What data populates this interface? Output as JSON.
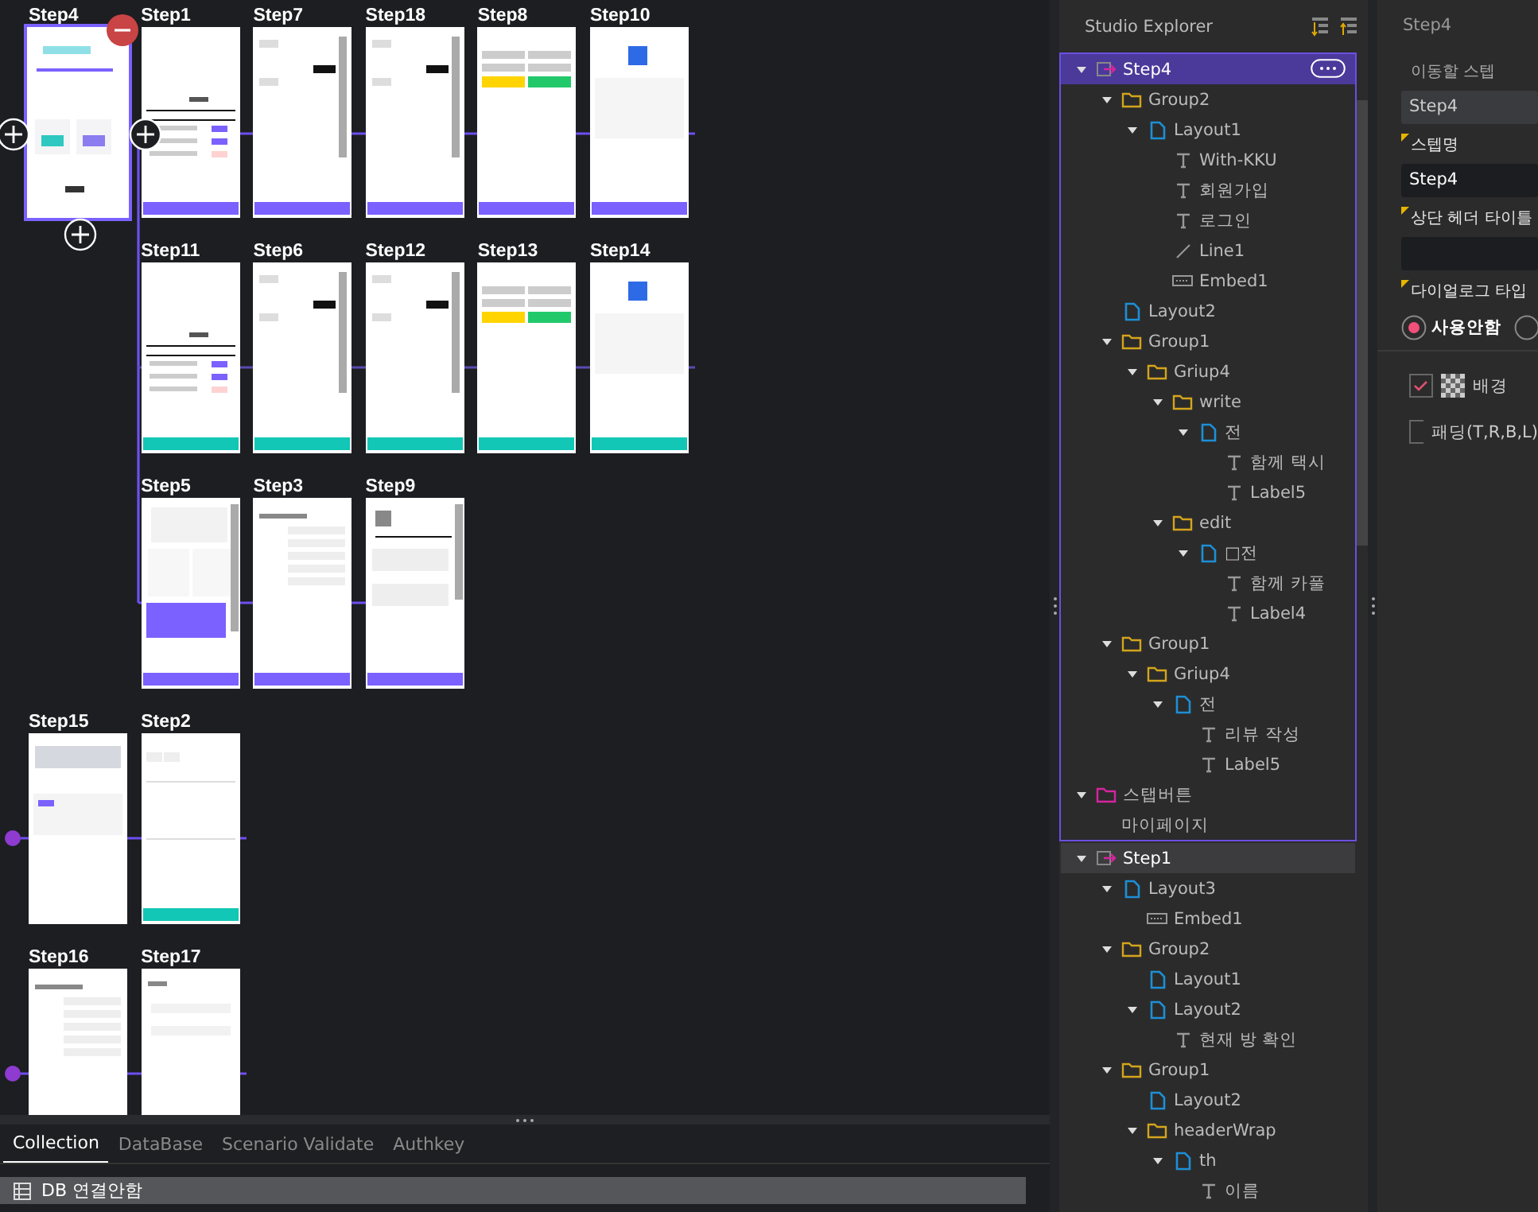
{
  "canvas": {
    "rows": [
      {
        "indented": false,
        "steps": [
          {
            "label": "Step4",
            "selected": true,
            "kind": "login"
          },
          {
            "label": "Step1",
            "selected": false,
            "kind": "table",
            "color": "#7b61ff"
          },
          {
            "label": "Step7",
            "selected": false,
            "kind": "chat",
            "color": "#7b61ff"
          },
          {
            "label": "Step18",
            "selected": false,
            "kind": "chat",
            "color": "#7b61ff"
          },
          {
            "label": "Step8",
            "selected": false,
            "kind": "options",
            "color": "#7b61ff"
          },
          {
            "label": "Step10",
            "selected": false,
            "kind": "done",
            "color": "#7b61ff"
          }
        ]
      },
      {
        "indented": true,
        "steps": [
          {
            "label": "Step11",
            "selected": false,
            "kind": "table",
            "color": "#12c7b5"
          },
          {
            "label": "Step6",
            "selected": false,
            "kind": "chat",
            "color": "#12c7b5"
          },
          {
            "label": "Step12",
            "selected": false,
            "kind": "chat",
            "color": "#12c7b5"
          },
          {
            "label": "Step13",
            "selected": false,
            "kind": "options",
            "color": "#12c7b5"
          },
          {
            "label": "Step14",
            "selected": false,
            "kind": "done",
            "color": "#12c7b5"
          }
        ]
      },
      {
        "indented": true,
        "steps": [
          {
            "label": "Step5",
            "selected": false,
            "kind": "mypage",
            "color": "#7b61ff"
          },
          {
            "label": "Step3",
            "selected": false,
            "kind": "form",
            "color": "#7b61ff"
          },
          {
            "label": "Step9",
            "selected": false,
            "kind": "review",
            "color": "#7b61ff"
          }
        ]
      },
      {
        "indented": false,
        "steps": [
          {
            "label": "Step15",
            "selected": false,
            "kind": "list"
          },
          {
            "label": "Step2",
            "selected": false,
            "kind": "write",
            "color": "#12c7b5"
          }
        ]
      },
      {
        "indented": false,
        "steps": [
          {
            "label": "Step16",
            "selected": false,
            "kind": "form"
          },
          {
            "label": "Step17",
            "selected": false,
            "kind": "simpleform"
          }
        ]
      }
    ]
  },
  "bottom_panel": {
    "tabs": [
      {
        "label": "Collection",
        "selected": true
      },
      {
        "label": "DataBase",
        "selected": false
      },
      {
        "label": "Scenario Validate",
        "selected": false
      },
      {
        "label": "Authkey",
        "selected": false
      }
    ],
    "status": "DB 연결안함"
  },
  "explorer": {
    "title": "Studio Explorer",
    "tree": [
      {
        "label": "Step4",
        "kind": "step",
        "selected": true,
        "expanded": true,
        "children": [
          {
            "label": "Group2",
            "kind": "folder",
            "expanded": true,
            "children": [
              {
                "label": "Layout1",
                "kind": "layout",
                "expanded": true,
                "children": [
                  {
                    "label": "With-KKU",
                    "kind": "text"
                  },
                  {
                    "label": "회원가입",
                    "kind": "text"
                  },
                  {
                    "label": "로그인",
                    "kind": "text"
                  },
                  {
                    "label": "Line1",
                    "kind": "line"
                  },
                  {
                    "label": "Embed1",
                    "kind": "embed"
                  }
                ]
              }
            ]
          },
          {
            "label": "Layout2",
            "kind": "layout"
          },
          {
            "label": "Group1",
            "kind": "folder",
            "expanded": true,
            "children": [
              {
                "label": "Griup4",
                "kind": "folder",
                "expanded": true,
                "children": [
                  {
                    "label": "write",
                    "kind": "folder",
                    "expanded": true,
                    "children": [
                      {
                        "label": "전",
                        "kind": "layout",
                        "expanded": true,
                        "children": [
                          {
                            "label": "함께 택시",
                            "kind": "text"
                          },
                          {
                            "label": "Label5",
                            "kind": "text"
                          }
                        ]
                      }
                    ]
                  },
                  {
                    "label": "edit",
                    "kind": "folder",
                    "expanded": true,
                    "children": [
                      {
                        "label": "□전",
                        "kind": "layout",
                        "expanded": true,
                        "children": [
                          {
                            "label": "함께 카풀",
                            "kind": "text"
                          },
                          {
                            "label": "Label4",
                            "kind": "text"
                          }
                        ]
                      }
                    ]
                  }
                ]
              }
            ]
          },
          {
            "label": "Group1",
            "kind": "folder",
            "expanded": true,
            "children": [
              {
                "label": "Griup4",
                "kind": "folder",
                "expanded": true,
                "children": [
                  {
                    "label": "전",
                    "kind": "layout",
                    "expanded": true,
                    "children": [
                      {
                        "label": "리뷰 작성",
                        "kind": "text"
                      },
                      {
                        "label": "Label5",
                        "kind": "text"
                      }
                    ]
                  }
                ]
              }
            ]
          },
          {
            "label": "스탭버튼",
            "kind": "stepbutton",
            "expanded": true,
            "children": [
              {
                "label": "마이페이지",
                "kind": "plain"
              }
            ]
          }
        ]
      },
      {
        "label": "Step1",
        "kind": "step",
        "selected": false,
        "expanded": true,
        "children": [
          {
            "label": "Layout3",
            "kind": "layout",
            "expanded": true,
            "children": [
              {
                "label": "Embed1",
                "kind": "embed"
              }
            ]
          },
          {
            "label": "Group2",
            "kind": "folder",
            "expanded": true,
            "children": [
              {
                "label": "Layout1",
                "kind": "layout"
              },
              {
                "label": "Layout2",
                "kind": "layout",
                "expanded": true,
                "children": [
                  {
                    "label": "현재 방 확인",
                    "kind": "text"
                  }
                ]
              }
            ]
          },
          {
            "label": "Group1",
            "kind": "folder",
            "expanded": true,
            "children": [
              {
                "label": "Layout2",
                "kind": "layout"
              },
              {
                "label": "headerWrap",
                "kind": "folder",
                "expanded": true,
                "children": [
                  {
                    "label": "th",
                    "kind": "layout",
                    "expanded": true,
                    "children": [
                      {
                        "label": "이름",
                        "kind": "text"
                      }
                    ]
                  }
                ]
              }
            ]
          }
        ]
      }
    ]
  },
  "properties": {
    "title": "Step4",
    "fields": [
      {
        "label": "이동할 스텝",
        "kind": "readonly",
        "required": false,
        "value": "Step4"
      },
      {
        "label": "스텝명",
        "kind": "input",
        "required": true,
        "value": "Step4"
      },
      {
        "label": "상단 헤더 타이틀",
        "kind": "input",
        "required": true
      }
    ],
    "dialog": {
      "label": "다이얼로그 타입",
      "required": true,
      "options": [
        {
          "label": "사용안함",
          "selected": true
        },
        {
          "selected": false
        }
      ]
    },
    "checks": [
      {
        "label": "배경",
        "checked": true,
        "swatch": true
      },
      {
        "label": "패딩(T,R,B,L)",
        "checked": false
      }
    ]
  }
}
